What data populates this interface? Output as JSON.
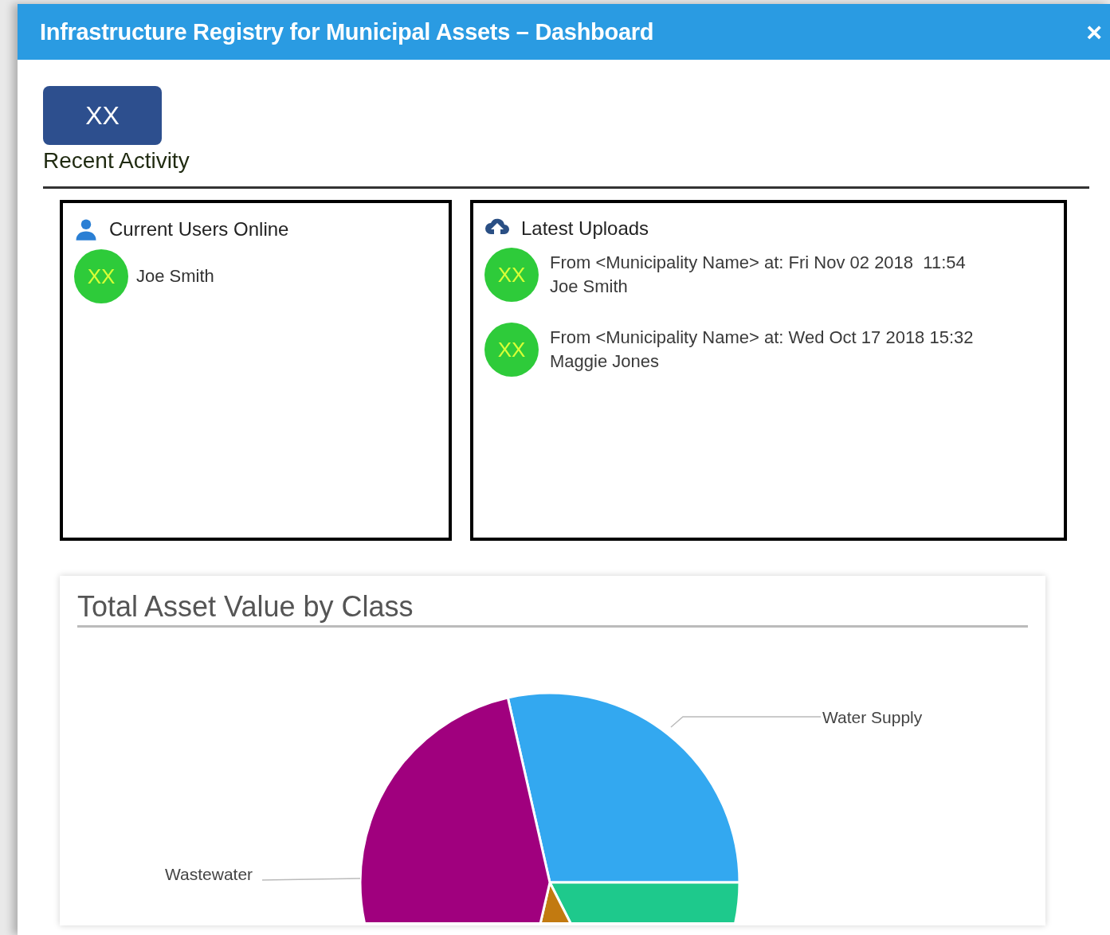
{
  "window": {
    "title": "Infrastructure Registry for Municipal Assets – Dashboard",
    "close": "×"
  },
  "badge": "XX",
  "section_title": "Recent Activity",
  "users_panel": {
    "title": "Current Users Online",
    "users": [
      {
        "avatar": "XX",
        "name": "Joe Smith"
      }
    ]
  },
  "uploads_panel": {
    "title": "Latest Uploads",
    "uploads": [
      {
        "avatar": "XX",
        "text": "From <Municipality Name> at: Fri Nov 02 2018  11:54",
        "user": "Joe Smith"
      },
      {
        "avatar": "XX",
        "text": "From <Municipality Name> at: Wed Oct 17 2018 15:32",
        "user": "Maggie Jones"
      }
    ]
  },
  "chart_card": {
    "title": "Total Asset Value by Class",
    "labels": [
      {
        "text": "Water Supply"
      },
      {
        "text": "Wastewater"
      }
    ]
  }
}
